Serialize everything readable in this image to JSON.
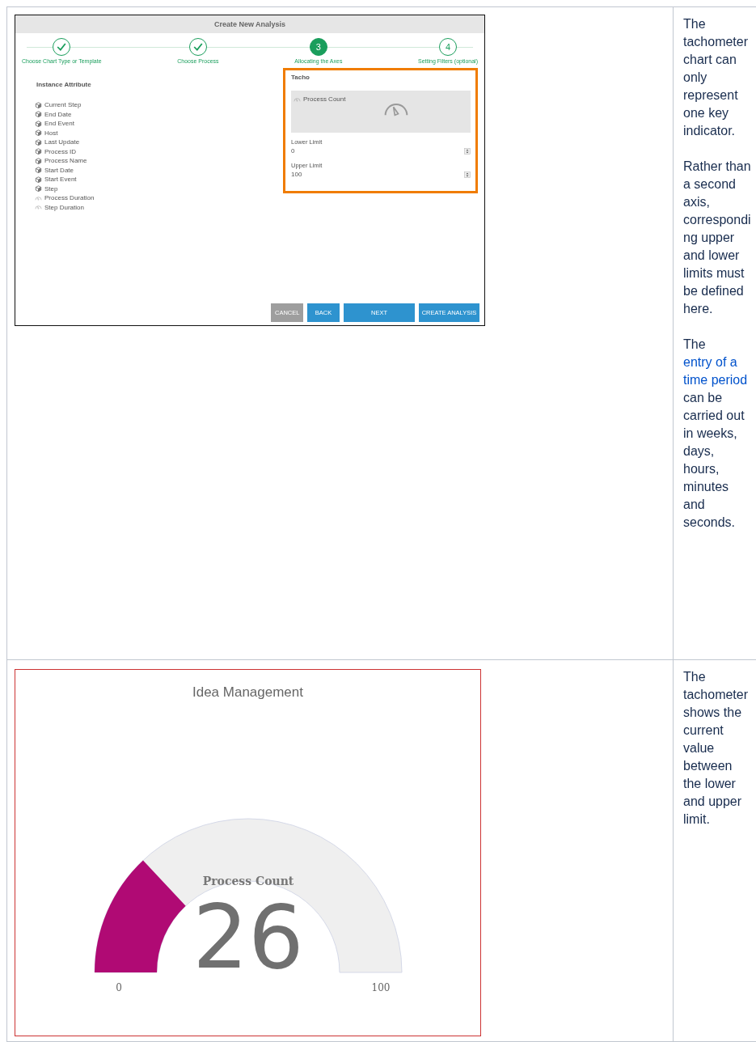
{
  "rows": [
    {
      "kind": "dialog",
      "dialog": {
        "title": "Create New Analysis",
        "steps": [
          {
            "label": "Choose Chart Type or Template",
            "completed": true,
            "selected": false
          },
          {
            "label": "Choose Process",
            "completed": true,
            "selected": false
          },
          {
            "label": "Allocating the Axes",
            "number": "3",
            "completed": false,
            "selected": true
          },
          {
            "label": "Setting Filters (optional)",
            "number": "4",
            "completed": false,
            "selected": false
          }
        ],
        "attributes_heading": "Instance Attribute",
        "attributes": [
          {
            "label": "Current Step",
            "kind": "dimension"
          },
          {
            "label": "End Date",
            "kind": "dimension"
          },
          {
            "label": "End Event",
            "kind": "dimension"
          },
          {
            "label": "Host",
            "kind": "dimension"
          },
          {
            "label": "Last Update",
            "kind": "dimension"
          },
          {
            "label": "Process ID",
            "kind": "dimension"
          },
          {
            "label": "Process Name",
            "kind": "dimension"
          },
          {
            "label": "Start Date",
            "kind": "dimension"
          },
          {
            "label": "Start Event",
            "kind": "dimension"
          },
          {
            "label": "Step",
            "kind": "dimension"
          },
          {
            "label": "Process Duration",
            "kind": "measure"
          },
          {
            "label": "Step Duration",
            "kind": "measure"
          }
        ],
        "panel": {
          "title": "Tacho",
          "measure": "Process Count",
          "fields": [
            {
              "label": "Lower Limit",
              "value": "0"
            },
            {
              "label": "Upper Limit",
              "value": "100"
            }
          ]
        },
        "buttons": [
          {
            "label": "CANCEL",
            "kind": "secondary"
          },
          {
            "label": "BACK",
            "kind": "primary"
          },
          {
            "label": "NEXT",
            "kind": "primary"
          },
          {
            "label": "CREATE ANALYSIS",
            "kind": "primary"
          }
        ]
      },
      "note": [
        {
          "text": "The tachometer chart can only represent one key indicator."
        },
        {
          "text": "Rather than a second axis, corresponding upper and lower limits must be defined here."
        },
        {
          "before": "The ",
          "link": "entry of a time period",
          "after": " can be carried out in weeks, days, hours, minutes and seconds."
        }
      ]
    },
    {
      "kind": "gauge",
      "gauge": {
        "title": "Idea Management",
        "label": "Process Count",
        "reading": "26",
        "level": 0.26,
        "min": "0",
        "max": "100"
      },
      "note": [
        {
          "text": "The tachometer shows the current value between the lower and upper limit."
        }
      ]
    }
  ]
}
